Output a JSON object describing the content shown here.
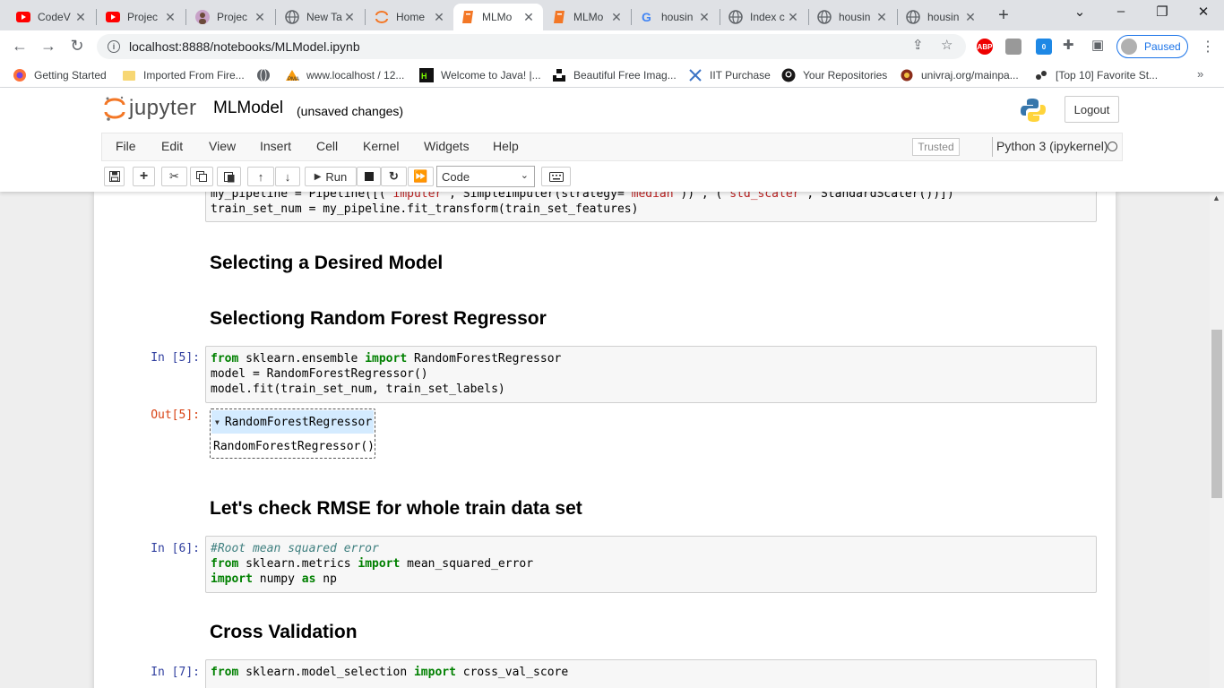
{
  "browser": {
    "tabs": [
      {
        "label": "CodeV",
        "icon": "youtube-icon"
      },
      {
        "label": "Projec",
        "icon": "youtube-icon"
      },
      {
        "label": "Projec",
        "icon": "avatar-icon"
      },
      {
        "label": "New Ta",
        "icon": "globe-icon"
      },
      {
        "label": "Home",
        "icon": "jupyter-icon"
      },
      {
        "label": "MLMo",
        "icon": "notebook-icon"
      },
      {
        "label": "MLMo",
        "icon": "notebook-icon"
      },
      {
        "label": "housin",
        "icon": "google-icon"
      },
      {
        "label": "Index c",
        "icon": "globe-icon"
      },
      {
        "label": "housin",
        "icon": "globe-icon"
      },
      {
        "label": "housin",
        "icon": "globe-icon"
      }
    ],
    "url": "localhost:8888/notebooks/MLModel.ipynb",
    "profile_status": "Paused",
    "extension_badge": "0",
    "abp_label": "ABP",
    "bookmarks": [
      {
        "label": "Getting Started",
        "icon": "firefox-icon"
      },
      {
        "label": "Imported From Fire...",
        "icon": "folder-icon"
      },
      {
        "label": "",
        "icon": "globe-icon"
      },
      {
        "label": "www.localhost / 12...",
        "icon": "phpmyadmin-icon"
      },
      {
        "label": "Welcome to Java! |...",
        "icon": "java-icon"
      },
      {
        "label": "Beautiful Free Imag...",
        "icon": "unsplash-icon"
      },
      {
        "label": "IIT Purchase",
        "icon": "iit-icon"
      },
      {
        "label": "Your Repositories",
        "icon": "github-icon"
      },
      {
        "label": "univraj.org/mainpa...",
        "icon": "university-icon"
      },
      {
        "label": "[Top 10] Favorite St...",
        "icon": "gaming-icon"
      }
    ]
  },
  "jupyter": {
    "logo_text": "jupyter",
    "notebook_name": "MLModel",
    "save_status": "(unsaved changes)",
    "logout_label": "Logout",
    "menu": [
      "File",
      "Edit",
      "View",
      "Insert",
      "Cell",
      "Kernel",
      "Widgets",
      "Help"
    ],
    "trusted_label": "Trusted",
    "kernel_name": "Python 3 (ipykernel)",
    "run_label": "Run",
    "cell_type": "Code"
  },
  "notebook": {
    "prev_cell_line1_a": "my_pipeline = Pipeline([(",
    "prev_cell_line1_s1": "'imputer'",
    "prev_cell_line1_b": ", SimpleImputer(strategy=",
    "prev_cell_line1_s2": "'median'",
    "prev_cell_line1_c": ")) , (",
    "prev_cell_line1_s3": "'std_scaler'",
    "prev_cell_line1_d": ", StandardScaler())])",
    "prev_cell_line2": "train_set_num = my_pipeline.fit_transform(train_set_features)",
    "heading1": "Selecting a Desired Model",
    "heading2": "Selectiong Random Forest Regressor",
    "cell5_prompt": "In [5]:",
    "cell5_kw_from": "from",
    "cell5_mod": " sklearn.ensemble ",
    "cell5_kw_import": "import",
    "cell5_name": " RandomForestRegressor",
    "cell5_line2": "model = RandomForestRegressor()",
    "cell5_line3": "model.fit(train_set_num, train_set_labels)",
    "out5_prompt": "Out[5]:",
    "out5_header": "RandomForestRegressor",
    "out5_body": "RandomForestRegressor()",
    "heading3": "Let's check RMSE for whole train data set",
    "cell6_prompt": "In [6]:",
    "cell6_comment": "#Root mean squared error",
    "cell6_kw_from": "from",
    "cell6_mod": " sklearn.metrics ",
    "cell6_kw_import": "import",
    "cell6_name": " mean_squared_error",
    "cell6_kw_import2": "import",
    "cell6_np": " numpy ",
    "cell6_kw_as": "as",
    "cell6_alias": " np",
    "heading4": "Cross Validation",
    "cell7_prompt": "In [7]:",
    "cell7_kw_from": "from",
    "cell7_mod": " sklearn.model_selection ",
    "cell7_kw_import": "import",
    "cell7_name": " cross_val_score"
  }
}
